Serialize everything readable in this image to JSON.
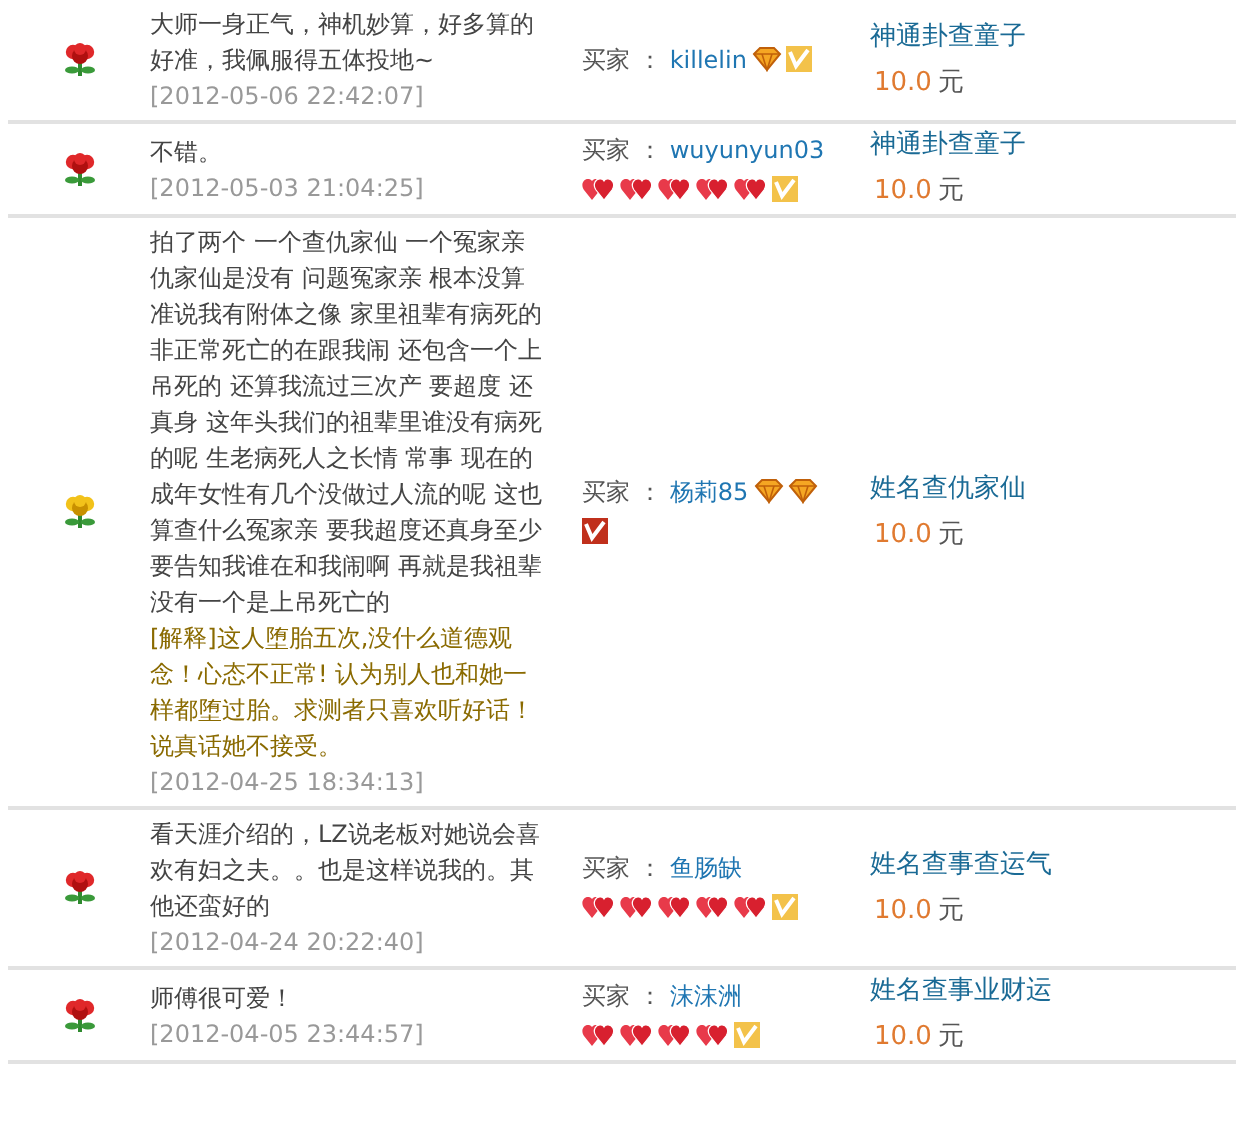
{
  "reviews": [
    {
      "kind": "good",
      "comment": "大师一身正气，神机妙算，好多算的好准，我佩服得五体投地~",
      "time": "[2012-05-06 22:42:07]",
      "buyer_label": "买家 ：",
      "buyer": "killelin",
      "badges": [
        {
          "kind": "diamond"
        },
        {
          "kind": "vip-gold"
        }
      ],
      "product": "神通卦查童子",
      "price": "10.0",
      "currency": "元"
    },
    {
      "kind": "good",
      "comment": "不错。",
      "time": "[2012-05-03 21:04:25]",
      "buyer_label": "买家 ：",
      "buyer": "wuyunyun03",
      "badges": [
        {
          "kind": "heart"
        },
        {
          "kind": "heart"
        },
        {
          "kind": "heart"
        },
        {
          "kind": "heart"
        },
        {
          "kind": "heart"
        },
        {
          "kind": "vip-gold"
        }
      ],
      "product": "神通卦查童子",
      "price": "10.0",
      "currency": "元"
    },
    {
      "kind": "neutral",
      "comment": "拍了两个 一个查仇家仙 一个冤家亲仇家仙是没有 问题冤家亲 根本没算准说我有附体之像 家里祖辈有病死的非正常死亡的在跟我闹 还包含一个上吊死的 还算我流过三次产 要超度 还真身 这年头我们的祖辈里谁没有病死的呢 生老病死人之长情 常事 现在的成年女性有几个没做过人流的呢 这也算查什么冤家亲 要我超度还真身至少要告知我谁在和我闹啊 再就是我祖辈没有一个是上吊死亡的",
      "explanation": "[解释]这人堕胎五次,没什么道德观念！心态不正常! 认为别人也和她一样都堕过胎。求测者只喜欢听好话！说真话她不接受。",
      "time": "[2012-04-25 18:34:13]",
      "buyer_label": "买家 ：",
      "buyer": "杨莉85",
      "badges": [
        {
          "kind": "diamond"
        },
        {
          "kind": "diamond"
        },
        {
          "kind": "vip-red"
        }
      ],
      "product": "姓名查仇家仙",
      "price": "10.0",
      "currency": "元"
    },
    {
      "kind": "good",
      "comment": "看天涯介绍的，LZ说老板对她说会喜欢有妇之夫。。也是这样说我的。其他还蛮好的",
      "time": "[2012-04-24 20:22:40]",
      "buyer_label": "买家 ：",
      "buyer": "鱼肠缺",
      "badges": [
        {
          "kind": "heart"
        },
        {
          "kind": "heart"
        },
        {
          "kind": "heart"
        },
        {
          "kind": "heart"
        },
        {
          "kind": "heart"
        },
        {
          "kind": "vip-gold"
        }
      ],
      "product": "姓名查事查运气",
      "price": "10.0",
      "currency": "元"
    },
    {
      "kind": "good",
      "comment": "师傅很可爱！",
      "time": "[2012-04-05 23:44:57]",
      "buyer_label": "买家 ：",
      "buyer": "沫沫洲",
      "badges": [
        {
          "kind": "heart"
        },
        {
          "kind": "heart"
        },
        {
          "kind": "heart"
        },
        {
          "kind": "heart"
        },
        {
          "kind": "vip-gold"
        }
      ],
      "product": "姓名查事业财运",
      "price": "10.0",
      "currency": "元"
    }
  ]
}
